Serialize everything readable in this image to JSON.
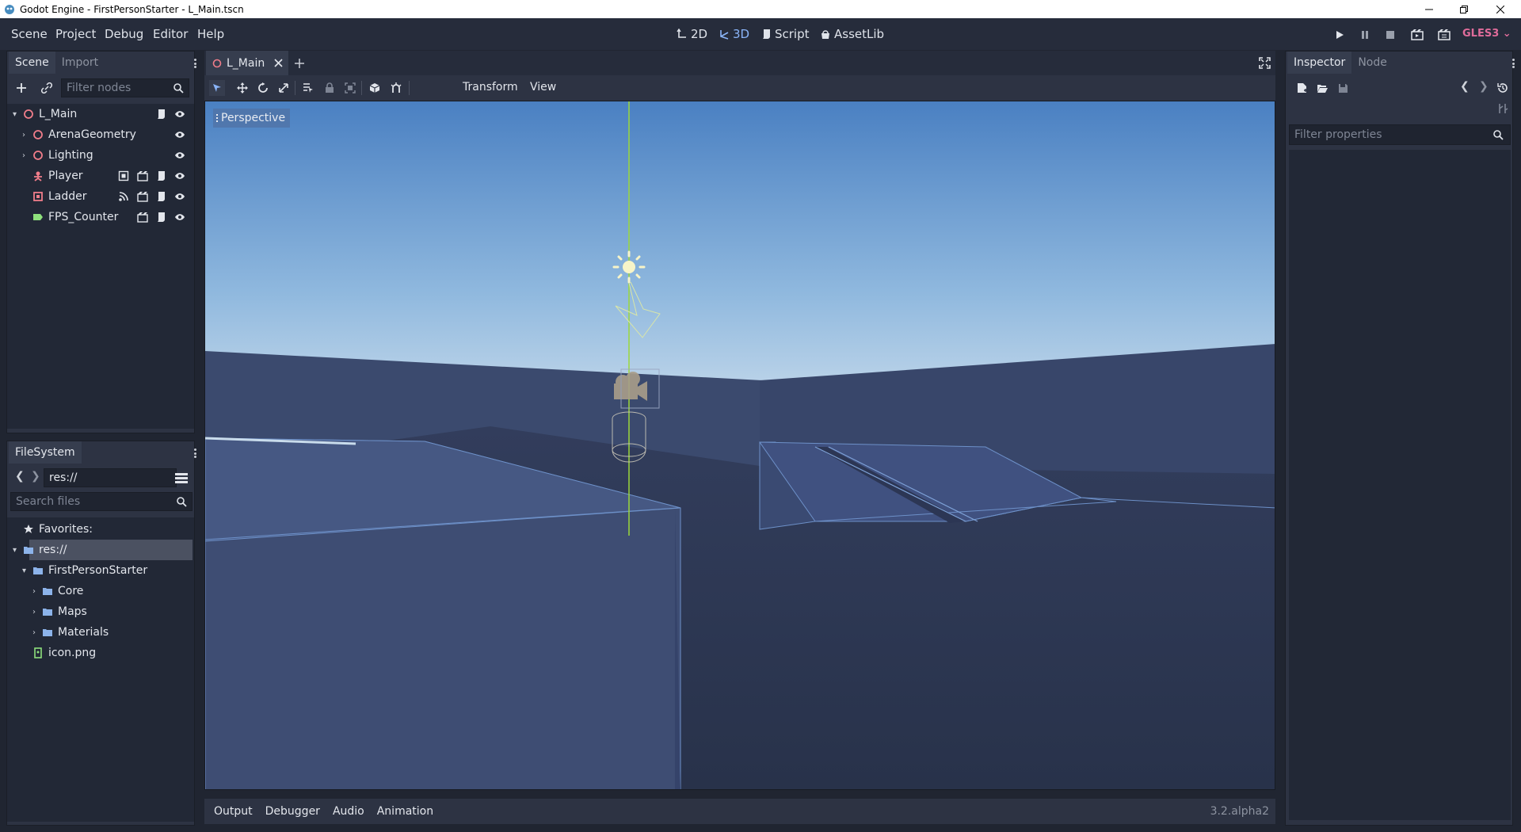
{
  "window": {
    "title": "Godot Engine - FirstPersonStarter - L_Main.tscn",
    "controls": [
      "minimize",
      "restore",
      "close"
    ]
  },
  "menu": {
    "items": [
      "Scene",
      "Project",
      "Debug",
      "Editor",
      "Help"
    ]
  },
  "workspaces": [
    {
      "label": "2D",
      "icon": "2d-icon",
      "active": false
    },
    {
      "label": "3D",
      "icon": "3d-icon",
      "active": true
    },
    {
      "label": "Script",
      "icon": "script-icon",
      "active": false
    },
    {
      "label": "AssetLib",
      "icon": "assetlib-icon",
      "active": false
    }
  ],
  "run_controls": [
    "play-icon",
    "pause-icon",
    "stop-icon",
    "play-scene-icon",
    "play-custom-scene-icon"
  ],
  "renderer": {
    "label": "GLES3",
    "color": "#e06c9b"
  },
  "scene_dock": {
    "tabs": [
      "Scene",
      "Import"
    ],
    "filter_placeholder": "Filter nodes",
    "nodes": [
      {
        "name": "L_Main",
        "icon": "spatial-icon",
        "expanded": true,
        "indent": 0,
        "badges": [
          "script-icon",
          "visible-eye-icon"
        ]
      },
      {
        "name": "ArenaGeometry",
        "icon": "spatial-icon",
        "expanded": false,
        "indent": 1,
        "badges": [
          "visible-eye-icon"
        ]
      },
      {
        "name": "Lighting",
        "icon": "spatial-icon",
        "expanded": false,
        "indent": 1,
        "badges": [
          "visible-eye-icon"
        ]
      },
      {
        "name": "Player",
        "icon": "kinematic-body-icon",
        "expanded": null,
        "indent": 1,
        "badges": [
          "group-icon",
          "instance-icon",
          "script-icon",
          "visible-eye-icon"
        ]
      },
      {
        "name": "Ladder",
        "icon": "area-icon",
        "expanded": null,
        "indent": 1,
        "badges": [
          "signal-icon",
          "instance-icon",
          "script-icon",
          "visible-eye-icon"
        ]
      },
      {
        "name": "FPS_Counter",
        "icon": "label-icon",
        "expanded": null,
        "indent": 1,
        "badges": [
          "instance-icon",
          "script-icon",
          "visible-eye-icon"
        ]
      }
    ]
  },
  "filesystem_dock": {
    "tab": "FileSystem",
    "path": "res://",
    "search_placeholder": "Search files",
    "favorites_label": "Favorites:",
    "items": [
      {
        "name": "res://",
        "icon": "folder-icon",
        "selected": true
      },
      {
        "name": "FirstPersonStarter",
        "icon": "folder-icon",
        "selected": false
      },
      {
        "name": "Core",
        "icon": "folder-icon",
        "selected": false
      },
      {
        "name": "Maps",
        "icon": "folder-icon",
        "selected": false
      },
      {
        "name": "Materials",
        "icon": "folder-icon",
        "selected": false
      },
      {
        "name": "icon.png",
        "icon": "image-file-icon",
        "selected": false
      }
    ]
  },
  "editor": {
    "scene_tab": "L_Main",
    "toolbar_menus": [
      "Transform",
      "View"
    ],
    "viewport_label": "Perspective"
  },
  "bottom_panel": {
    "tabs": [
      "Output",
      "Debugger",
      "Audio",
      "Animation"
    ],
    "version": "3.2.alpha2"
  },
  "inspector": {
    "tabs": [
      "Inspector",
      "Node"
    ],
    "filter_placeholder": "Filter properties"
  },
  "colors": {
    "accent": "#8ab4f8",
    "node_icon_red": "#f07d8a",
    "node_icon_green": "#8ee07c",
    "folder": "#8cb3ea"
  }
}
